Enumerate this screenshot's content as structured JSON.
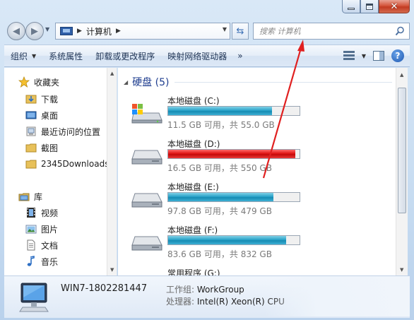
{
  "nav": {
    "address": {
      "computer_label": "计算机"
    },
    "search": {
      "placeholder": "搜索 计算机"
    }
  },
  "toolbar": {
    "organize": "组织",
    "system_properties": "系统属性",
    "uninstall": "卸载或更改程序",
    "map_drive": "映射网络驱动器",
    "more": "»"
  },
  "sidebar": {
    "favorites": {
      "title": "收藏夹",
      "items": [
        {
          "label": "下载",
          "icon": "download-folder-icon"
        },
        {
          "label": "桌面",
          "icon": "desktop-icon"
        },
        {
          "label": "最近访问的位置",
          "icon": "recent-places-icon"
        },
        {
          "label": "截图",
          "icon": "folder-icon"
        },
        {
          "label": "2345Downloads",
          "icon": "folder-icon"
        }
      ]
    },
    "libraries": {
      "title": "库",
      "items": [
        {
          "label": "视频",
          "icon": "video-library-icon"
        },
        {
          "label": "图片",
          "icon": "pictures-library-icon"
        },
        {
          "label": "文档",
          "icon": "documents-library-icon"
        },
        {
          "label": "音乐",
          "icon": "music-library-icon"
        }
      ]
    }
  },
  "content": {
    "group_title": "硬盘 (5)",
    "drives": [
      {
        "label": "本地磁盘 (C:)",
        "size": "11.5 GB 可用，共 55.0 GB",
        "used_fraction": 0.79,
        "state": "normal",
        "icon": "system-drive-icon"
      },
      {
        "label": "本地磁盘 (D:)",
        "size": "16.5 GB 可用，共 550 GB",
        "used_fraction": 0.97,
        "state": "full",
        "icon": "hard-drive-icon"
      },
      {
        "label": "本地磁盘 (E:)",
        "size": "97.8 GB 可用，共 479 GB",
        "used_fraction": 0.8,
        "state": "normal",
        "icon": "hard-drive-icon"
      },
      {
        "label": "本地磁盘 (F:)",
        "size": "83.6 GB 可用，共 832 GB",
        "used_fraction": 0.9,
        "state": "normal",
        "icon": "hard-drive-icon"
      },
      {
        "label": "常用程序 (G:)",
        "size": "",
        "used_fraction": 0,
        "state": "normal",
        "icon": "hard-drive-icon"
      }
    ]
  },
  "details": {
    "computer_name": "WIN7-1802281447",
    "workgroup_label": "工作组:",
    "workgroup_value": "WorkGroup",
    "cpu_label": "处理器:",
    "cpu_value": "Intel(R) Xeon(R) CPU"
  },
  "colors": {
    "bar_normal": "#2aa3c9",
    "bar_full": "#e01515",
    "annotation": "#e02020"
  }
}
